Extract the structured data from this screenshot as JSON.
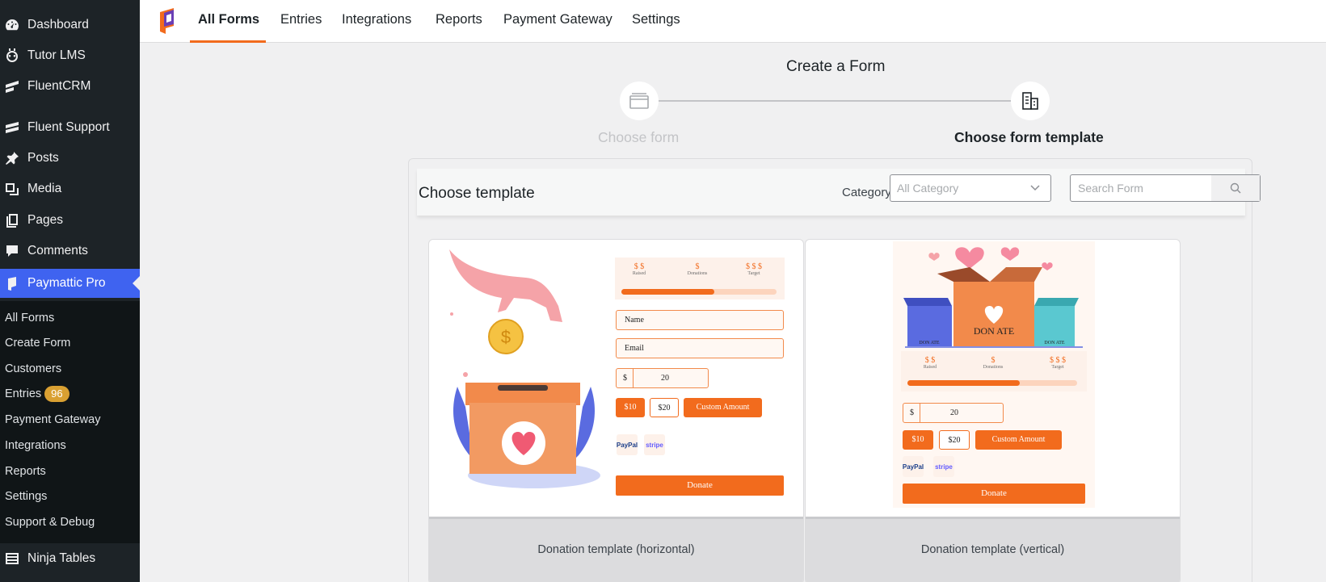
{
  "sidebar": {
    "items": [
      {
        "label": "Dashboard",
        "icon": "dashboard-icon"
      },
      {
        "label": "Tutor LMS",
        "icon": "tutor-icon"
      },
      {
        "label": "FluentCRM",
        "icon": "fluentcrm-icon"
      },
      {
        "label": "Fluent Support",
        "icon": "fluent-support-icon"
      },
      {
        "label": "Posts",
        "icon": "pin-icon"
      },
      {
        "label": "Media",
        "icon": "media-icon"
      },
      {
        "label": "Pages",
        "icon": "pages-icon"
      },
      {
        "label": "Comments",
        "icon": "comment-icon"
      },
      {
        "label": "Paymattic Pro",
        "icon": "paymattic-icon"
      },
      {
        "label": "Ninja Tables",
        "icon": "table-icon"
      }
    ],
    "submenu": [
      {
        "label": "All Forms"
      },
      {
        "label": "Create Form"
      },
      {
        "label": "Customers"
      },
      {
        "label": "Entries",
        "badge": "96"
      },
      {
        "label": "Payment Gateway"
      },
      {
        "label": "Integrations"
      },
      {
        "label": "Reports"
      },
      {
        "label": "Settings"
      },
      {
        "label": "Support & Debug"
      }
    ]
  },
  "topnav": {
    "tabs": [
      {
        "label": "All Forms",
        "active": true
      },
      {
        "label": "Entries"
      },
      {
        "label": "Integrations"
      },
      {
        "label": "Reports"
      },
      {
        "label": "Payment Gateway"
      },
      {
        "label": "Settings"
      }
    ]
  },
  "stepper": {
    "title": "Create a Form",
    "steps": [
      {
        "label": "Choose form",
        "state": "done"
      },
      {
        "label": "Choose form template",
        "state": "current"
      }
    ]
  },
  "panel": {
    "title": "Choose template",
    "category_label": "Category",
    "category_value": "All Category",
    "search_placeholder": "Search Form"
  },
  "templates": [
    {
      "name": "Donation template (horizontal)",
      "preview": {
        "stats": [
          {
            "value": "$ $",
            "label": "Raised"
          },
          {
            "value": "$",
            "label": "Donations"
          },
          {
            "value": "$ $ $",
            "label": "Target"
          }
        ],
        "progress": 0.6,
        "fields": [
          "Name",
          "Email"
        ],
        "currency": "$",
        "amount": "20",
        "amount_buttons": [
          "$10",
          "$20"
        ],
        "custom_amount": "Custom Amount",
        "payment_methods": [
          "PayPal",
          "stripe"
        ],
        "submit": "Donate"
      }
    },
    {
      "name": "Donation template (vertical)",
      "preview": {
        "box_text": "DON ATE",
        "stats": [
          {
            "value": "$ $",
            "label": "Raised"
          },
          {
            "value": "$",
            "label": "Donations"
          },
          {
            "value": "$ $ $",
            "label": "Target"
          }
        ],
        "progress": 0.66,
        "currency": "$",
        "amount": "20",
        "amount_buttons": [
          "$10",
          "$20"
        ],
        "custom_amount": "Custom Amount",
        "payment_methods": [
          "PayPal",
          "stripe"
        ],
        "submit": "Donate"
      }
    }
  ],
  "colors": {
    "accent": "#f26b1d",
    "sidebar_bg": "#1d2327",
    "active_menu": "#3f63f0"
  }
}
